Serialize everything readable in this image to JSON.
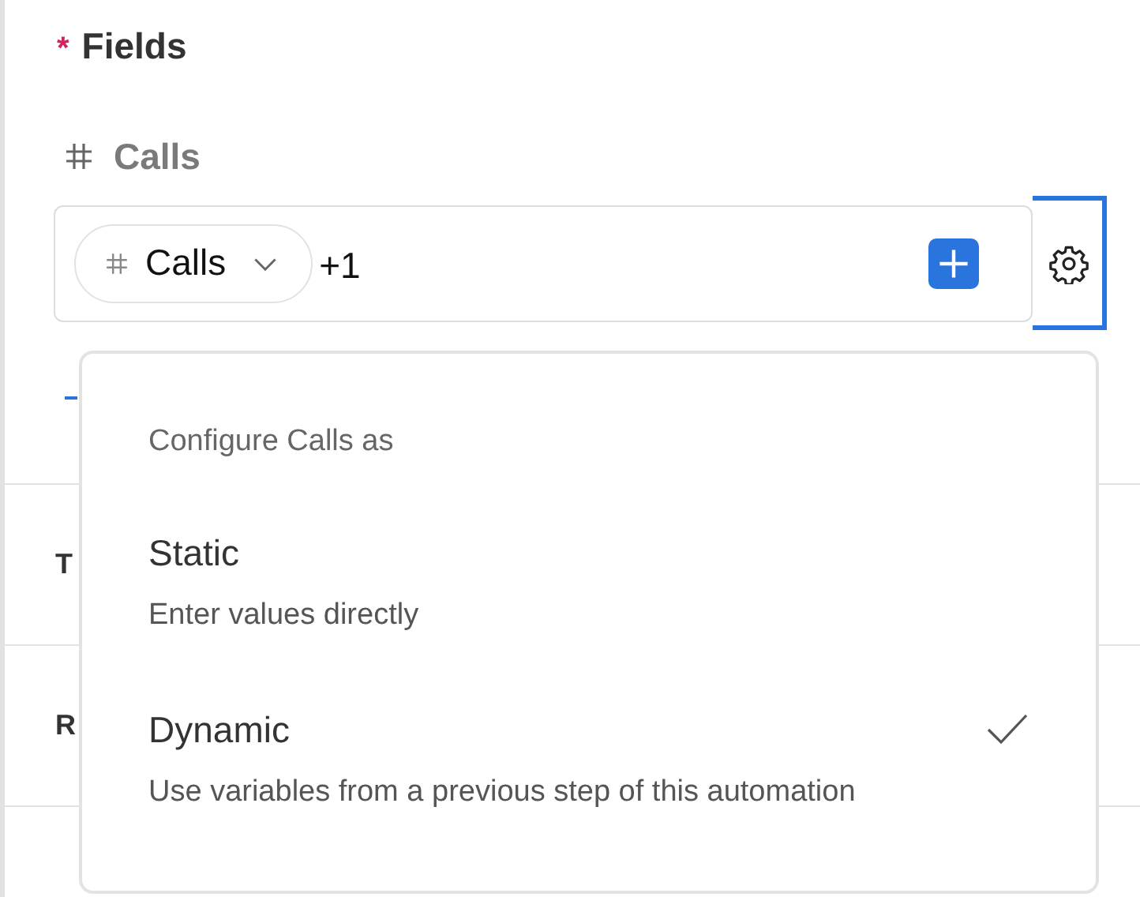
{
  "section": {
    "required_mark": "*",
    "title": "Fields"
  },
  "field": {
    "label": "Calls",
    "chip": {
      "label": "Calls"
    },
    "extra_count": "+1"
  },
  "settings_button": {
    "focused": true
  },
  "rows": [
    {
      "label": "T"
    },
    {
      "label": "R"
    }
  ],
  "menu": {
    "heading": "Configure Calls as",
    "options": [
      {
        "title": "Static",
        "description": "Enter values directly",
        "selected": false
      },
      {
        "title": "Dynamic",
        "description": "Use variables from a previous step of this automation",
        "selected": true
      }
    ]
  }
}
